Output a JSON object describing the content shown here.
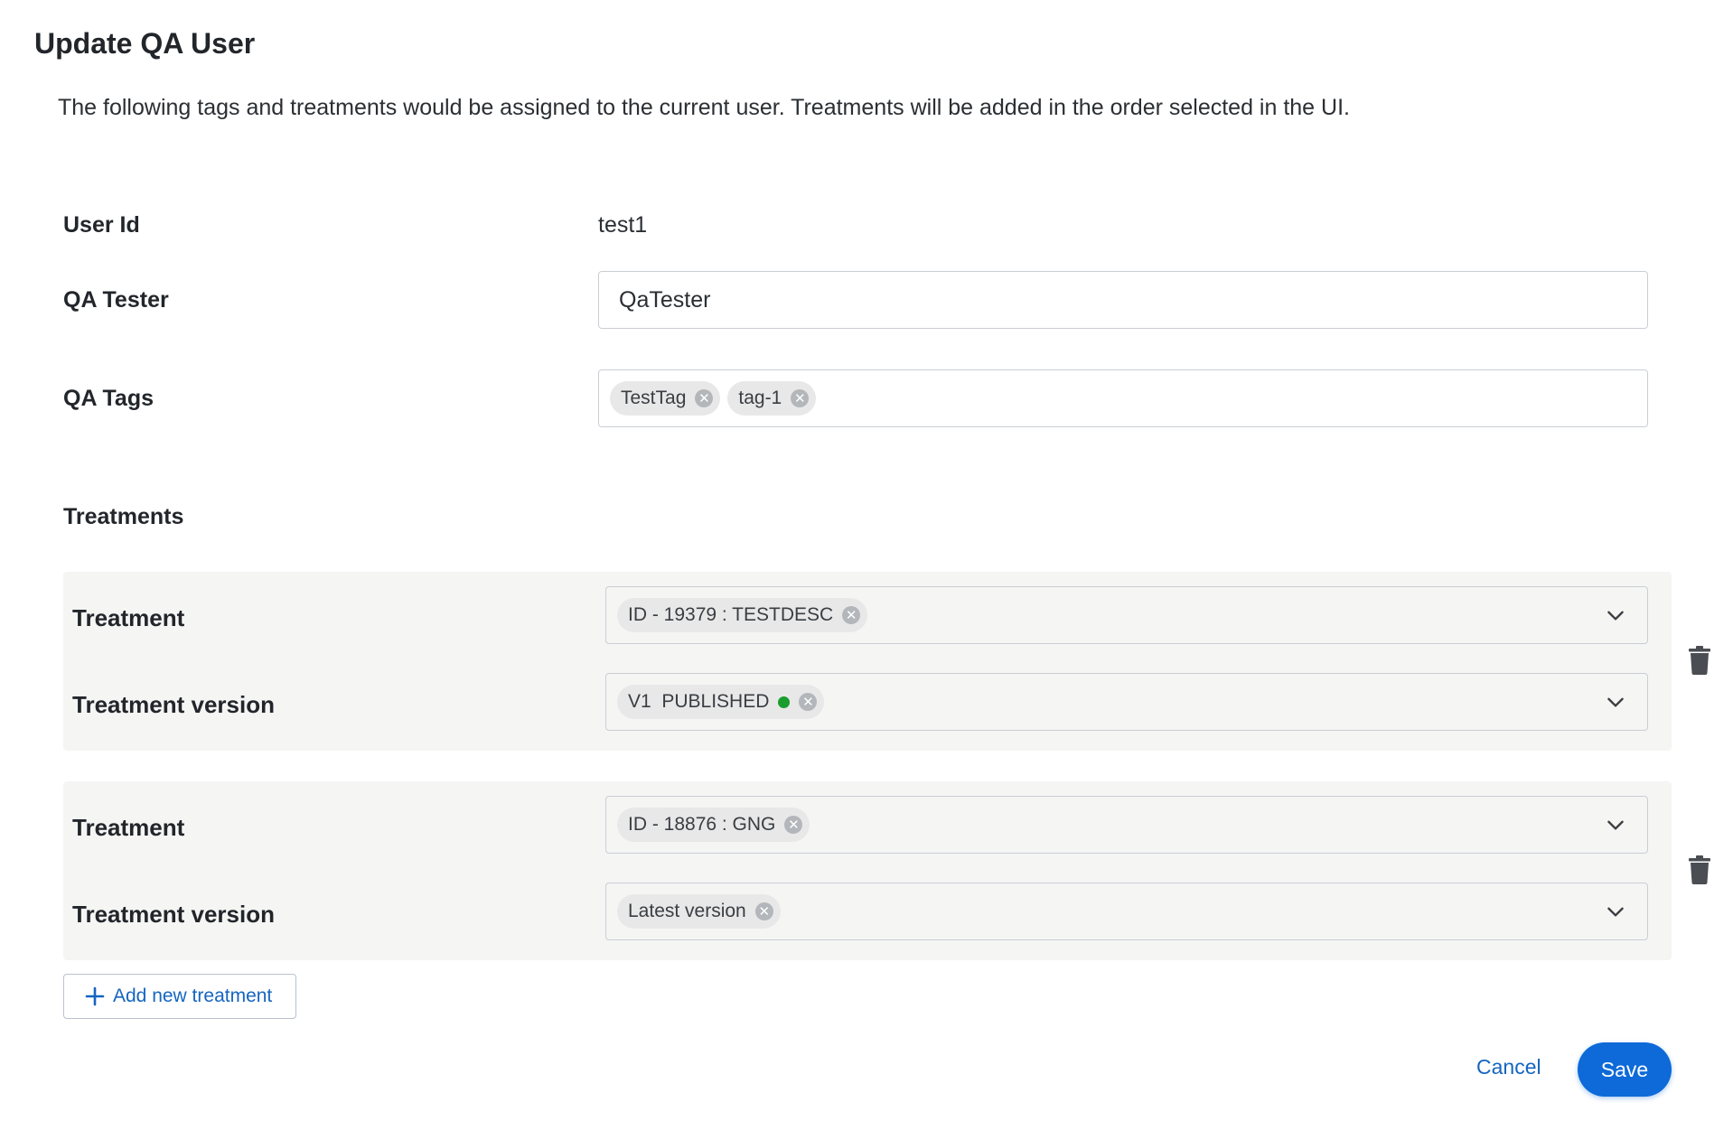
{
  "dialog": {
    "title": "Update QA User",
    "description": "The following tags and treatments would be assigned to the current user. Treatments will be added in the order selected in the UI."
  },
  "form": {
    "user_id_label": "User Id",
    "user_id_value": "test1",
    "qa_tester_label": "QA Tester",
    "qa_tester_value": "QaTester",
    "qa_tags_label": "QA Tags",
    "qa_tags": [
      "TestTag",
      "tag-1"
    ]
  },
  "treatments": {
    "section_title": "Treatments",
    "items": [
      {
        "treatment_label": "Treatment",
        "treatment_value": "ID - 19379 : TESTDESC",
        "version_label": "Treatment version",
        "version_value": "V1  PUBLISHED",
        "version_status_color": "#1a9d2e"
      },
      {
        "treatment_label": "Treatment",
        "treatment_value": "ID - 18876 : GNG",
        "version_label": "Treatment version",
        "version_value": "Latest version"
      }
    ],
    "add_label": "Add new treatment"
  },
  "actions": {
    "cancel_label": "Cancel",
    "save_label": "Save"
  },
  "colors": {
    "primary": "#0d6ad8",
    "link": "#1565c0",
    "block_bg": "#f5f5f4",
    "published": "#1a9d2e"
  },
  "icons": {
    "chip_remove": "close-circle-icon",
    "dropdown": "chevron-down-icon",
    "delete": "trash-icon",
    "add": "plus-icon"
  }
}
